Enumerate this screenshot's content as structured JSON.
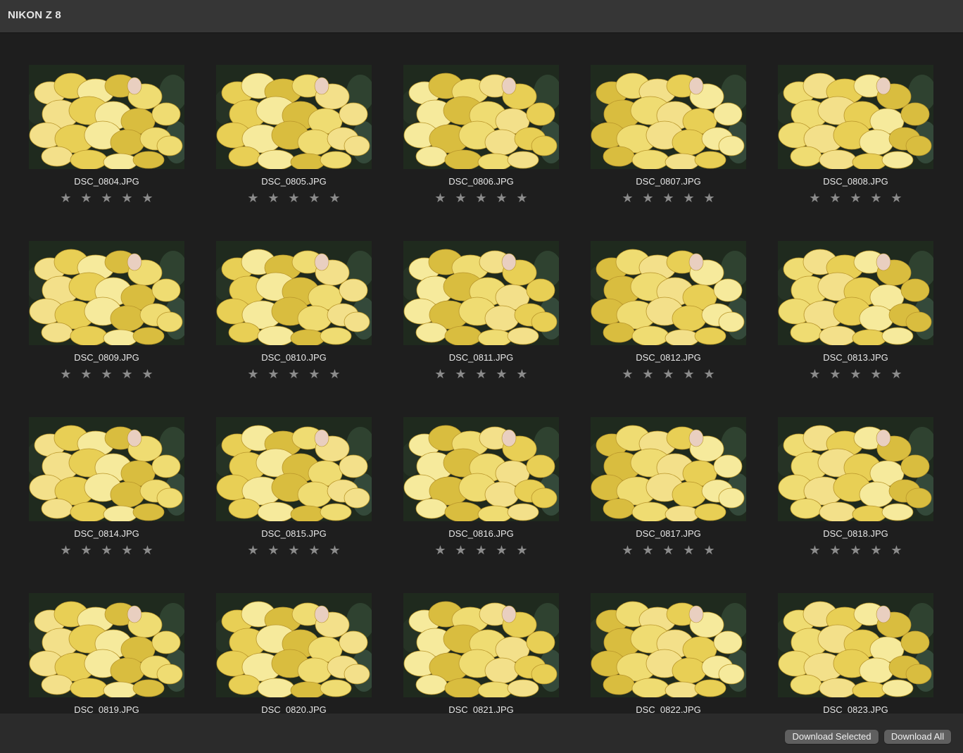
{
  "window": {
    "title": "NIKON Z 8"
  },
  "colors": {
    "background": "#1e1e1e",
    "titlebar": "#363636",
    "bottombar": "#2b2b2b",
    "star": "#8b8b8b",
    "button": "#5f5f5f"
  },
  "star_glyph": "★",
  "photos": [
    {
      "filename": "DSC_0804.JPG",
      "rating": 0
    },
    {
      "filename": "DSC_0805.JPG",
      "rating": 0
    },
    {
      "filename": "DSC_0806.JPG",
      "rating": 0
    },
    {
      "filename": "DSC_0807.JPG",
      "rating": 0
    },
    {
      "filename": "DSC_0808.JPG",
      "rating": 0
    },
    {
      "filename": "DSC_0809.JPG",
      "rating": 0
    },
    {
      "filename": "DSC_0810.JPG",
      "rating": 0
    },
    {
      "filename": "DSC_0811.JPG",
      "rating": 0
    },
    {
      "filename": "DSC_0812.JPG",
      "rating": 0
    },
    {
      "filename": "DSC_0813.JPG",
      "rating": 0
    },
    {
      "filename": "DSC_0814.JPG",
      "rating": 0
    },
    {
      "filename": "DSC_0815.JPG",
      "rating": 0
    },
    {
      "filename": "DSC_0816.JPG",
      "rating": 0
    },
    {
      "filename": "DSC_0817.JPG",
      "rating": 0
    },
    {
      "filename": "DSC_0818.JPG",
      "rating": 0
    },
    {
      "filename": "DSC_0819.JPG",
      "rating": 0
    },
    {
      "filename": "DSC_0820.JPG",
      "rating": 0
    },
    {
      "filename": "DSC_0821.JPG",
      "rating": 0
    },
    {
      "filename": "DSC_0822.JPG",
      "rating": 0
    },
    {
      "filename": "DSC_0823.JPG",
      "rating": 0
    }
  ],
  "footer": {
    "download_selected_label": "Download Selected",
    "download_all_label": "Download All"
  }
}
